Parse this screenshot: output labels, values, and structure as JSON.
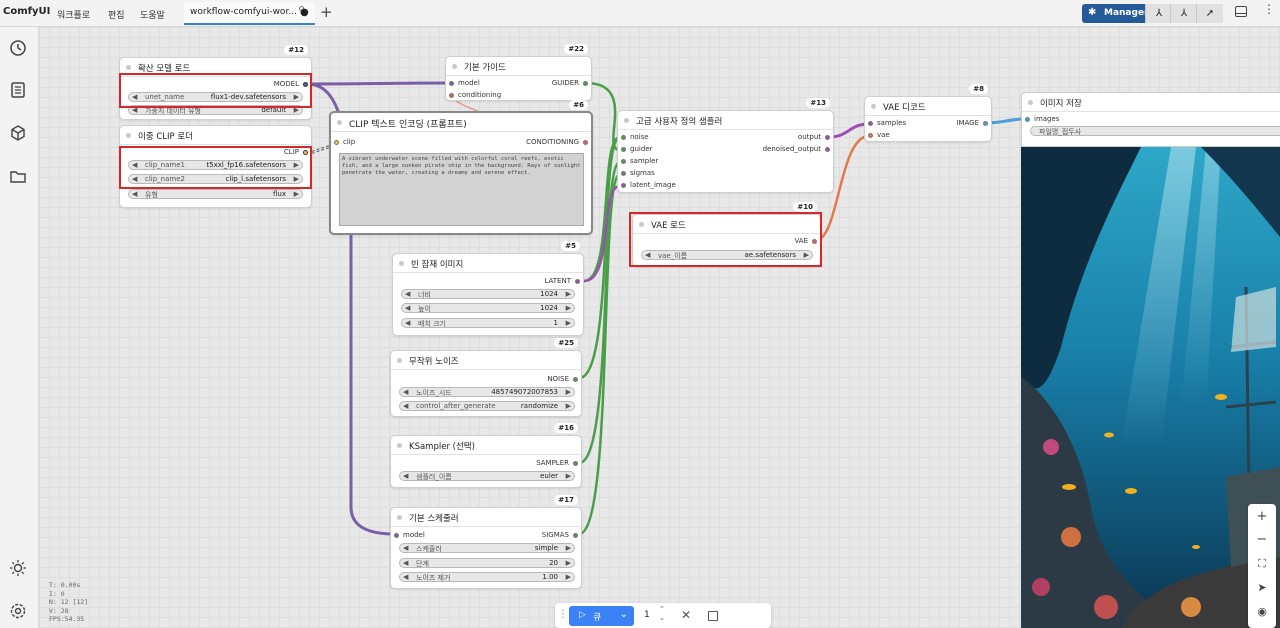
{
  "app": {
    "logo": "ComfyUI",
    "menu": [
      "워크플로",
      "편집",
      "도움말"
    ],
    "tab_label": "workflow-comfyui-wor...",
    "tab_modified": "●",
    "add_tab": "+",
    "manager_label": "Manager",
    "accent_color": "#24599a"
  },
  "sidebar_icons": [
    "history-icon",
    "document-icon",
    "cube-icon",
    "folder-icon",
    "sun-icon",
    "settings-icon"
  ],
  "nodes": {
    "model_load": {
      "badge": "#12",
      "title": "확산 모델 로드",
      "out": "MODEL",
      "w1_name": "unet_name",
      "w1_val": "flux1-dev.safetensors",
      "w2_name": "가중치 데이터 유형",
      "w2_val": "default"
    },
    "dual_clip": {
      "title": "이중 CLIP 로더",
      "out": "CLIP",
      "w1_name": "clip_name1",
      "w1_val": "t5xxl_fp16.safetensors",
      "w2_name": "clip_name2",
      "w2_val": "clip_l.safetensors",
      "w3_name": "유형",
      "w3_val": "flux"
    },
    "basic_guider": {
      "badge": "#22",
      "title": "기본 가이드",
      "in1": "model",
      "in2": "conditioning",
      "out": "GUIDER"
    },
    "clip_text": {
      "badge": "#6",
      "title": "CLIP 텍스트 인코딩 (프롬프트)",
      "in1": "clip",
      "out": "CONDITIONING",
      "prompt": "A vibrant underwater scene filled with colorful coral reefs, exotic fish, and a large sunken pirate ship in the background. Rays of sunlight penetrate the water, creating a dreamy and serene effect."
    },
    "sampler_custom": {
      "badge": "#13",
      "title": "고급 사용자 정의 샘플러",
      "in": [
        "noise",
        "guider",
        "sampler",
        "sigmas",
        "latent_image"
      ],
      "out1": "output",
      "out2": "denoised_output"
    },
    "vae_decode": {
      "badge": "#8",
      "title": "VAE 디코드",
      "in1": "samples",
      "in2": "vae",
      "out": "IMAGE"
    },
    "save_image": {
      "title": "이미지 저장",
      "in1": "images",
      "w1_name": "파일명_접두사"
    },
    "vae_load": {
      "badge": "#10",
      "title": "VAE 로드",
      "out": "VAE",
      "w1_name": "vae_이름",
      "w1_val": "ae.safetensors"
    },
    "empty_latent": {
      "badge": "#5",
      "title": "빈 잠재 이미지",
      "out": "LATENT",
      "w1_name": "너비",
      "w1_val": "1024",
      "w2_name": "높이",
      "w2_val": "1024",
      "w3_name": "배치 크기",
      "w3_val": "1"
    },
    "random_noise": {
      "badge": "#25",
      "title": "무작위 노이즈",
      "out": "NOISE",
      "w1_name": "노이즈_시드",
      "w1_val": "485749072007853",
      "w2_name": "control_after_generate",
      "w2_val": "randomize"
    },
    "ksampler_select": {
      "badge": "#16",
      "title": "KSampler (선택)",
      "out": "SAMPLER",
      "w1_name": "샘플러_이름",
      "w1_val": "euler"
    },
    "basic_scheduler": {
      "badge": "#17",
      "title": "기본 스케줄러",
      "in1": "model",
      "out": "SIGMAS",
      "w1_name": "스케줄러",
      "w1_val": "simple",
      "w2_name": "단계",
      "w2_val": "20",
      "w3_name": "노이즈 제거",
      "w3_val": "1.00"
    }
  },
  "stats": [
    "T: 0.00s",
    "I: 0",
    "N: 12 [12]",
    "V: 28",
    "FPS:54.35"
  ],
  "runbar": {
    "run_label": "큐",
    "count": "1"
  },
  "colors": {
    "model_wire": "#7b5ea8",
    "clip_wire": "#f0c53c",
    "conditioning_wire": "#e06060",
    "latent_wire": "#9c4fb0",
    "vae_wire": "#e07a4a",
    "image_wire": "#4aa0d8",
    "generic_wire": "#4a9e4a",
    "highlight": "#d62828"
  }
}
